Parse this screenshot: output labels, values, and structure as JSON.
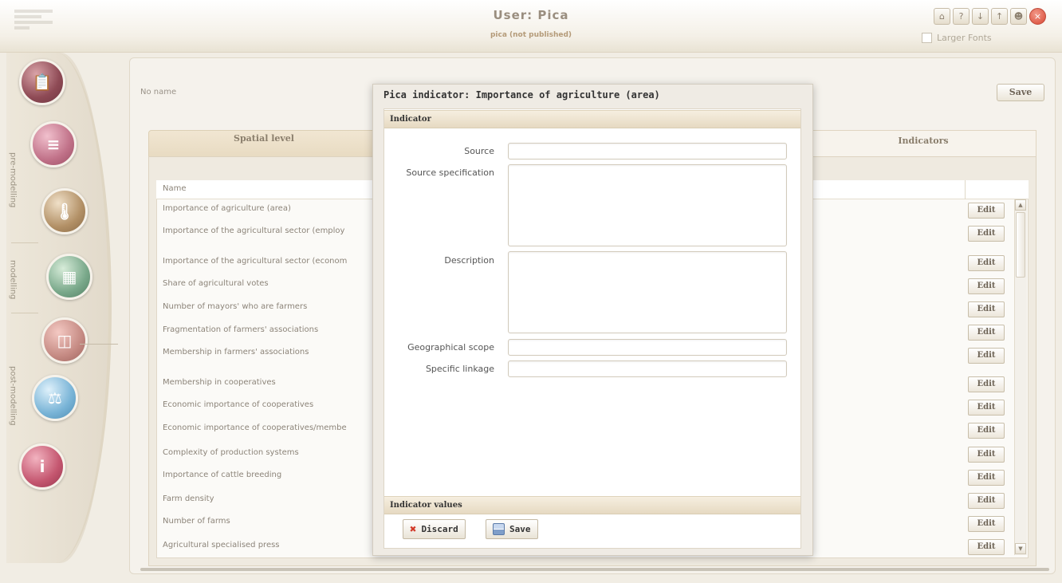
{
  "header": {
    "title": "User: Pica",
    "subtitle": "pica (not published)",
    "larger_fonts_label": "Larger Fonts",
    "icons": [
      "home-icon",
      "help-icon",
      "download-icon",
      "upload-icon",
      "users-icon",
      "close-icon"
    ]
  },
  "rail": {
    "labels": {
      "pre": "pre-modelling",
      "modelling": "modelling",
      "post": "post-modelling"
    },
    "items": [
      {
        "name": "clipboard-icon",
        "glyph": "📋"
      },
      {
        "name": "books-icon",
        "glyph": "📚"
      },
      {
        "name": "thermometer-icon",
        "glyph": "🌡"
      },
      {
        "name": "calculator-icon",
        "glyph": "▦"
      },
      {
        "name": "chart-icon",
        "glyph": "◫"
      },
      {
        "name": "scales-icon",
        "glyph": "⚖"
      },
      {
        "name": "info-icon",
        "glyph": "i"
      }
    ]
  },
  "main": {
    "no_name": "No name",
    "save_label": "Save",
    "tab_spatial": "Spatial level",
    "tab_indicators": "Indicators",
    "column_name": "Name",
    "edit_label": "Edit",
    "rows": [
      "Importance of agriculture (area)",
      "Importance of the agricultural sector (employ",
      "Importance of the agricultural sector (econom",
      "Share of agricultural votes",
      "Number of mayors' who are farmers",
      "Fragmentation of farmers' associations",
      "Membership in farmers' associations",
      "Membership in cooperatives",
      "Economic importance of  cooperatives",
      "Economic importance of  cooperatives/membe",
      "Complexity of production systems",
      "Importance of cattle breeding",
      "Farm density",
      "Number of farms",
      "Agricultural specialised press"
    ]
  },
  "modal": {
    "title": "Pica indicator: Importance of agriculture (area)",
    "section_indicator": "Indicator",
    "section_values": "Indicator values",
    "fields": {
      "source": {
        "label": "Source",
        "value": ""
      },
      "source_specification": {
        "label": "Source specification",
        "value": ""
      },
      "description": {
        "label": "Description",
        "value": ""
      },
      "geographical_scope": {
        "label": "Geographical scope",
        "value": ""
      },
      "specific_linkage": {
        "label": "Specific linkage",
        "value": ""
      }
    },
    "discard_label": "Discard",
    "save_label": "Save"
  }
}
